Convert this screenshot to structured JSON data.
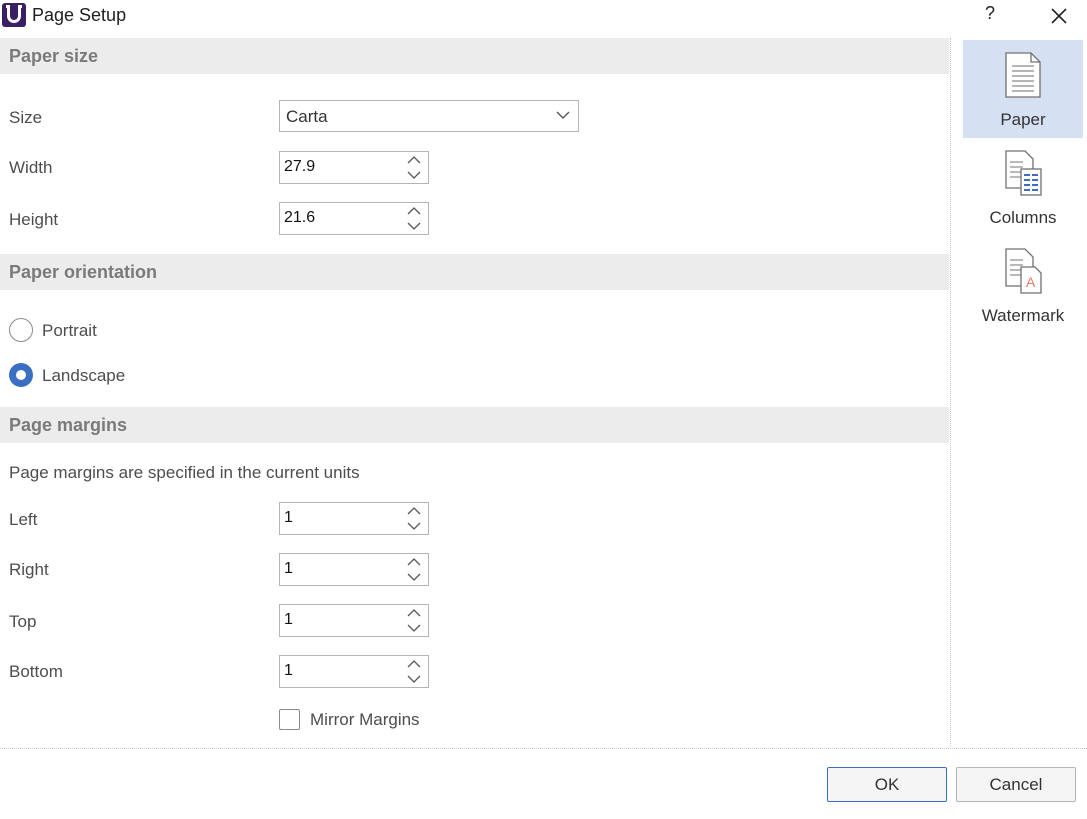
{
  "window": {
    "title": "Page Setup",
    "help": "?"
  },
  "paper_size": {
    "header": "Paper size",
    "size_label": "Size",
    "size_value": "Carta",
    "width_label": "Width",
    "width_value": "27.9",
    "height_label": "Height",
    "height_value": "21.6"
  },
  "orientation": {
    "header": "Paper orientation",
    "portrait_label": "Portrait",
    "landscape_label": "Landscape",
    "selected": "Landscape"
  },
  "margins": {
    "header": "Page margins",
    "note": "Page margins are specified in the current units",
    "left_label": "Left",
    "left_value": "1",
    "right_label": "Right",
    "right_value": "1",
    "top_label": "Top",
    "top_value": "1",
    "bottom_label": "Bottom",
    "bottom_value": "1",
    "mirror_label": "Mirror Margins",
    "mirror_checked": false
  },
  "nav": {
    "items": [
      {
        "label": "Paper",
        "icon": "page-icon",
        "active": true
      },
      {
        "label": "Columns",
        "icon": "columns-page-icon",
        "active": false
      },
      {
        "label": "Watermark",
        "icon": "watermark-page-icon",
        "active": false
      }
    ]
  },
  "buttons": {
    "ok": "OK",
    "cancel": "Cancel"
  },
  "colors": {
    "accent": "#3b6fc2",
    "nav_active_bg": "#d5e0f2",
    "section_bg": "#ececec",
    "app_icon": "#3b1f63"
  }
}
